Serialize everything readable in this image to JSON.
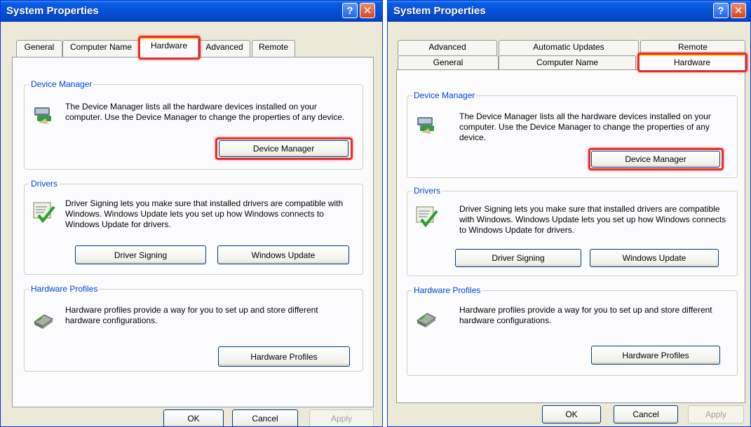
{
  "left_dialog": {
    "title": "System Properties",
    "tabs": [
      "General",
      "Computer Name",
      "Hardware",
      "Advanced",
      "Remote"
    ],
    "active_tab": "Hardware",
    "device_manager": {
      "legend": "Device Manager",
      "description": "The Device Manager lists all the hardware devices installed on your computer. Use the Device Manager to change the properties of any device.",
      "button": "Device Manager"
    },
    "drivers": {
      "legend": "Drivers",
      "description": "Driver Signing lets you make sure that installed drivers are compatible with Windows. Windows Update lets you set up how Windows connects to Windows Update for drivers.",
      "signing_button": "Driver Signing",
      "update_button": "Windows Update"
    },
    "hardware_profiles": {
      "legend": "Hardware Profiles",
      "description": "Hardware profiles provide a way for you to set up and store different hardware configurations.",
      "button": "Hardware Profiles"
    },
    "footer": {
      "ok": "OK",
      "cancel": "Cancel",
      "apply": "Apply"
    }
  },
  "right_dialog": {
    "title": "System Properties",
    "tabs_row1": [
      "Advanced",
      "Automatic Updates",
      "Remote"
    ],
    "tabs_row2": [
      "General",
      "Computer Name",
      "Hardware"
    ],
    "active_tab": "Hardware",
    "device_manager": {
      "legend": "Device Manager",
      "description": "The Device Manager lists all the hardware devices installed on your computer. Use the Device Manager to change the properties of any device.",
      "button": "Device Manager"
    },
    "drivers": {
      "legend": "Drivers",
      "description": "Driver Signing lets you make sure that installed drivers are compatible with Windows. Windows Update lets you set up how Windows connects to Windows Update for drivers.",
      "signing_button": "Driver Signing",
      "update_button": "Windows Update"
    },
    "hardware_profiles": {
      "legend": "Hardware Profiles",
      "description": "Hardware profiles provide a way for you to set up and store different hardware configurations.",
      "button": "Hardware Profiles"
    },
    "footer": {
      "ok": "OK",
      "cancel": "Cancel",
      "apply": "Apply"
    }
  },
  "icons": {
    "help": "help-icon",
    "close": "close-icon",
    "device_manager": "device-manager-icon",
    "drivers": "driver-signing-icon",
    "hardware_profiles": "hardware-profiles-icon"
  },
  "colors": {
    "titlebar": "#0650d8",
    "dialog_bg": "#ece9d8",
    "pane_bg": "#fcfcfe",
    "legend": "#0046d5",
    "highlight": "#e03030",
    "active_tab_accent": "#ffc83c"
  }
}
